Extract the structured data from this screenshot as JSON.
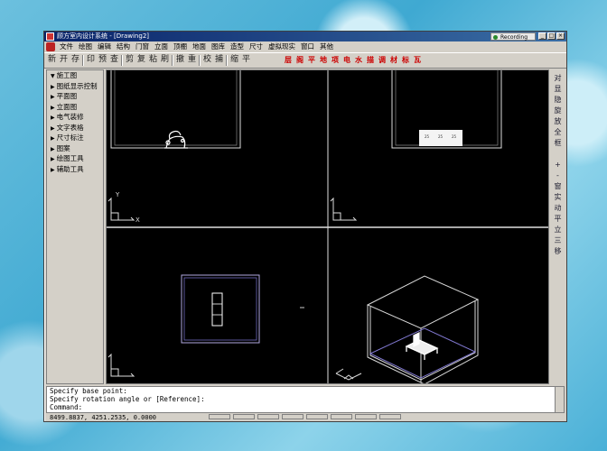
{
  "window": {
    "title": "顾方室内设计系统 - [Drawing2]",
    "recording": "Recording",
    "buttons": [
      "_",
      "□",
      "×"
    ]
  },
  "menu": [
    "文件",
    "绘图",
    "编辑",
    "结构",
    "门窗",
    "立面",
    "顶棚",
    "地面",
    "图库",
    "造型",
    "尺寸",
    "虚拟现实",
    "窗口",
    "其他"
  ],
  "toolbar": {
    "quick_tools": [
      "新",
      "开",
      "存",
      "印",
      "预",
      "查",
      "剪",
      "复",
      "粘",
      "刷",
      "撤",
      "重",
      "校",
      "捕",
      "缩",
      "平"
    ],
    "tool_labels": [
      "层",
      "阁",
      "平",
      "地",
      "项",
      "电",
      "水",
      "描",
      "调",
      "材",
      "标",
      "瓦"
    ]
  },
  "sidebar": {
    "items": [
      {
        "label": "施工图",
        "expanded": true
      },
      {
        "label": "图纸显示控制",
        "expanded": false
      },
      {
        "label": "平面图",
        "expanded": false
      },
      {
        "label": "立面图",
        "expanded": false
      },
      {
        "label": "电气装修",
        "expanded": false
      },
      {
        "label": "文字表格",
        "expanded": false
      },
      {
        "label": "尺寸标注",
        "expanded": false
      },
      {
        "label": "图案",
        "expanded": false
      },
      {
        "label": "绘图工具",
        "expanded": false
      },
      {
        "label": "辅助工具",
        "expanded": false
      }
    ]
  },
  "viewports": {
    "ucs_x": "X",
    "ucs_y": "Y",
    "table_labels": [
      "25",
      "25",
      "25"
    ]
  },
  "right_tools": [
    "对",
    "显",
    "隐",
    "旋",
    "放",
    "全",
    "框",
    "+",
    "-",
    "窗",
    "实",
    "动",
    "平",
    "立",
    "三",
    "移"
  ],
  "command": {
    "lines": [
      "Specify base point:",
      "Specify rotation angle or [Reference]:",
      "Command:"
    ]
  },
  "status": {
    "coords": "8499.8837, 4251.2535, 0.0000"
  }
}
